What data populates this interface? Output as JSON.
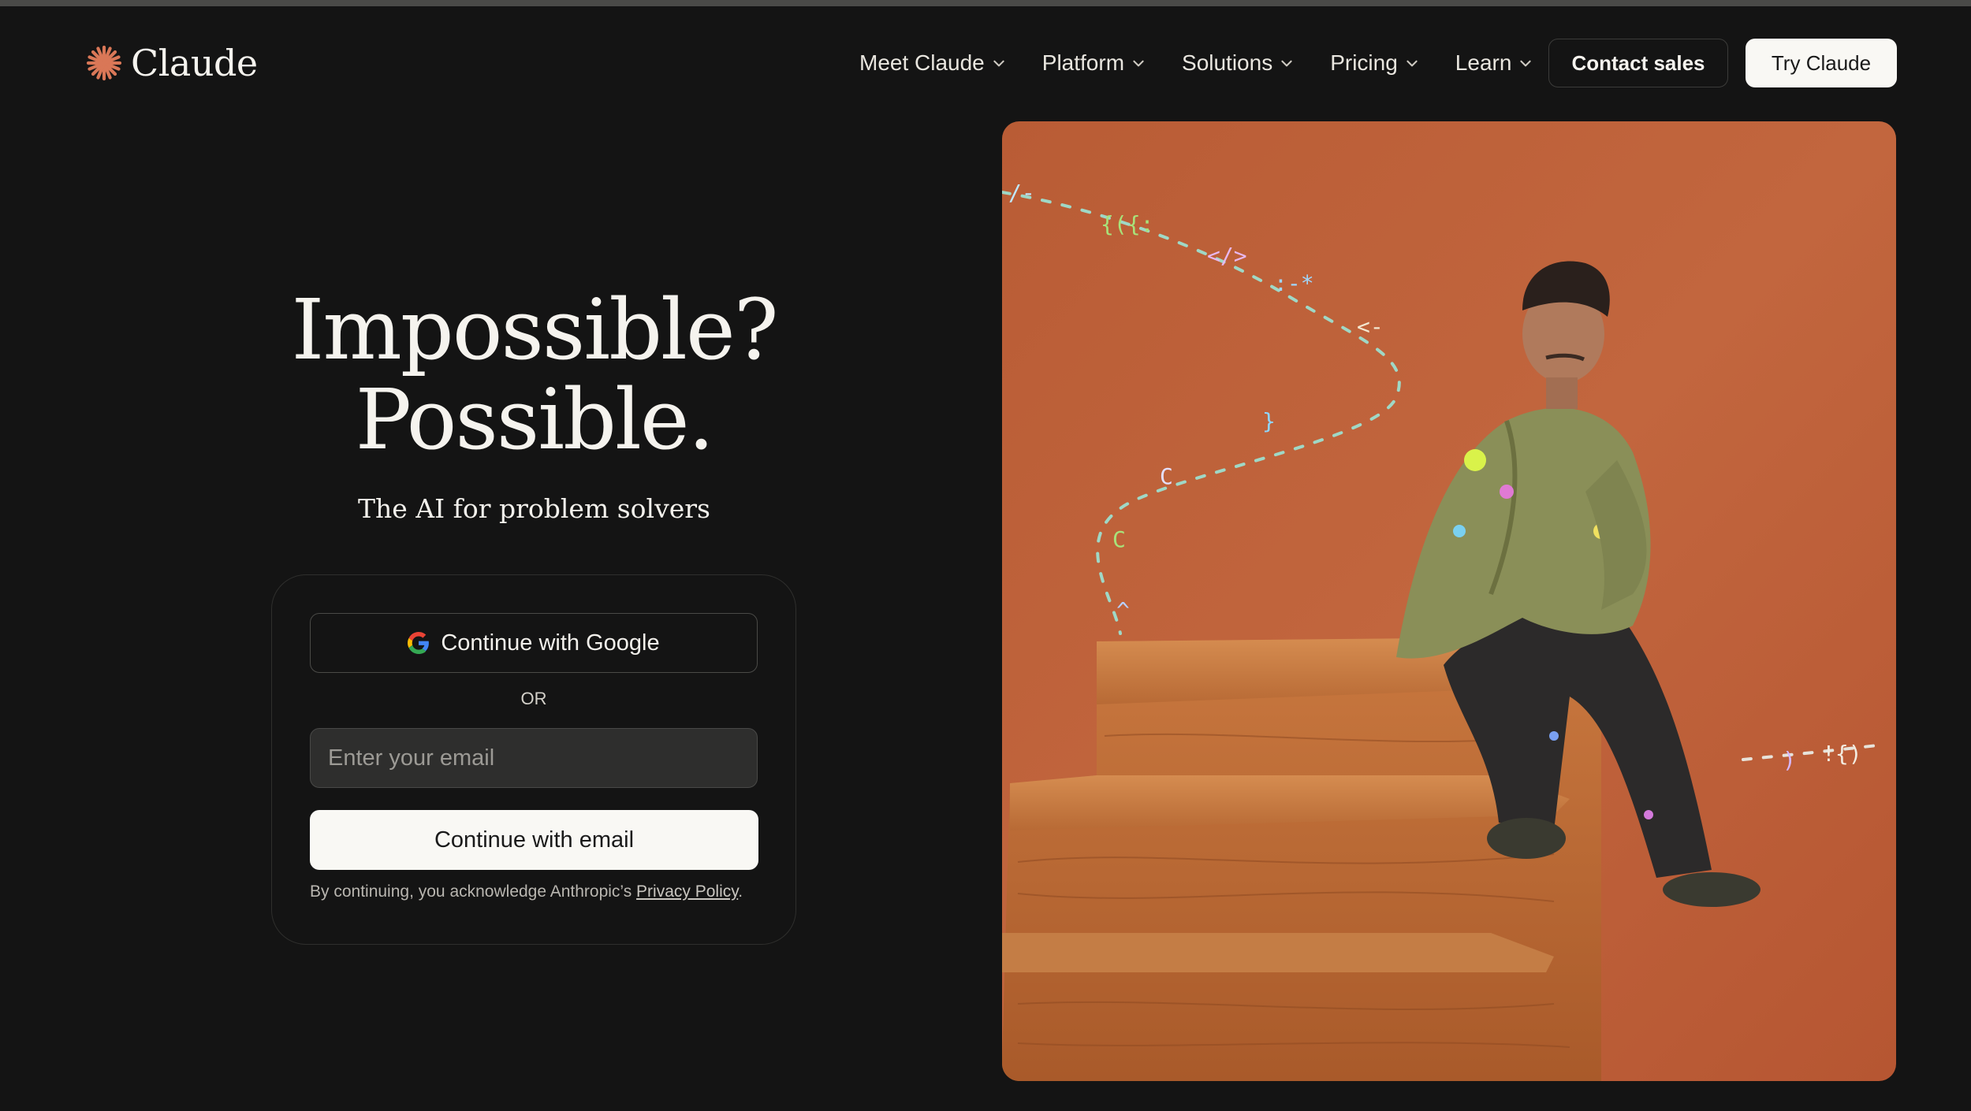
{
  "header": {
    "logo_text": "Claude",
    "logo_icon": "claude-starburst-icon",
    "nav": [
      {
        "label": "Meet Claude"
      },
      {
        "label": "Platform"
      },
      {
        "label": "Solutions"
      },
      {
        "label": "Pricing"
      },
      {
        "label": "Learn"
      }
    ],
    "contact_sales": "Contact sales",
    "try_claude": "Try Claude"
  },
  "hero": {
    "headline_line1": "Impossible?",
    "headline_line2": "Possible.",
    "tagline": "The AI for problem solvers"
  },
  "signup": {
    "google_label": "Continue with Google",
    "or_label": "OR",
    "email_placeholder": "Enter your email",
    "email_value": "",
    "email_button": "Continue with email",
    "legal_prefix": "By continuing, you acknowledge Anthropic’s ",
    "privacy_link": "Privacy Policy",
    "legal_suffix": "."
  },
  "colors": {
    "background": "#141414",
    "accent": "#d97757",
    "photo_background": "#c0643c"
  }
}
